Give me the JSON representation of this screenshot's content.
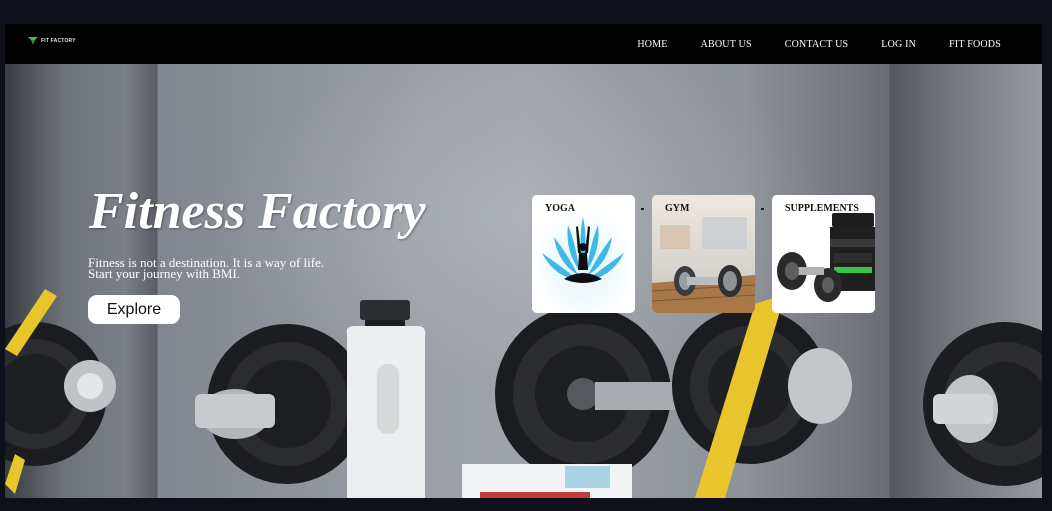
{
  "navbar": {
    "logo_text": "FIT FACTORY",
    "links": [
      "HOME",
      "ABOUT US",
      "CONTACT US",
      "LOG IN",
      "FIT FOODS"
    ]
  },
  "hero": {
    "title": "Fitness Factory",
    "tagline_line1": "Fitness is not a destination. It is a way of life.",
    "tagline_line2": "Start your journey with BMI.",
    "cta_label": "Explore"
  },
  "cards": [
    {
      "label": "YOGA",
      "icon": "yoga-icon"
    },
    {
      "label": "GYM",
      "icon": "dumbbell-icon"
    },
    {
      "label": "SUPPLEMENTS",
      "icon": "protein-icon"
    }
  ],
  "colors": {
    "page_bg": "#0e1119",
    "navbar_bg": "#020202",
    "accent_green": "#39c24a",
    "text_light": "#ffffff",
    "tape_yellow": "#e8c52b"
  }
}
